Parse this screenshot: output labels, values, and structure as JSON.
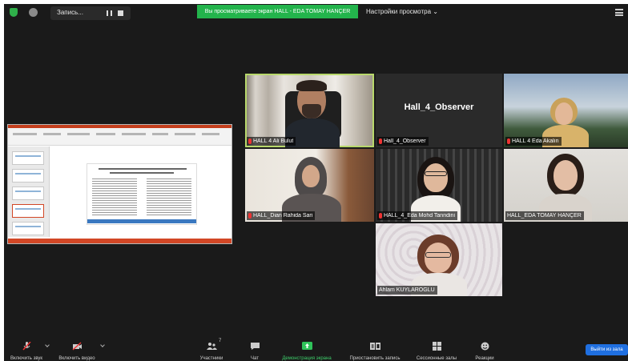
{
  "topbar": {
    "recording_label": "Запись...",
    "viewing_banner": "Вы просматриваете экран HALL - EDA TOMAY HANÇER",
    "view_options": "Настройки просмотра ⌄"
  },
  "shared_screen": {
    "slide_heading": "",
    "app": "PowerPoint"
  },
  "participants": [
    {
      "name": "HALL 4 Ali Bulut",
      "muted": true,
      "active_speaker": true
    },
    {
      "name": "Hall_4_Observer",
      "muted": true,
      "video": false
    },
    {
      "name": "HALL 4 Eda Akalın",
      "muted": true
    },
    {
      "name": "HALL_Dian Rahida Sari",
      "muted": true
    },
    {
      "name": "HALL_4_Eda Mohd Tanndini",
      "muted": false
    },
    {
      "name": "HALL_EDA TOMAY HANÇER",
      "muted": false
    },
    {
      "name": "Ahlam KUYLAROGLU",
      "muted": false
    }
  ],
  "toolbar": {
    "mic_label": "Включить звук",
    "video_label": "Включить видео",
    "participants_label": "Участники",
    "participants_count": "7",
    "chat_label": "Чат",
    "share_label": "Демонстрация экрана",
    "pause_record_label": "Приостановить запись",
    "breakout_label": "Сессионные залы",
    "reactions_label": "Реакции",
    "leave_label": "Выйти из зала"
  },
  "colors": {
    "background": "#1a1a1a",
    "banner_green": "#23b44c",
    "active_speaker_outline": "#b8d86b",
    "mute_red": "#e33333",
    "leave_blue": "#1f6fe0"
  }
}
